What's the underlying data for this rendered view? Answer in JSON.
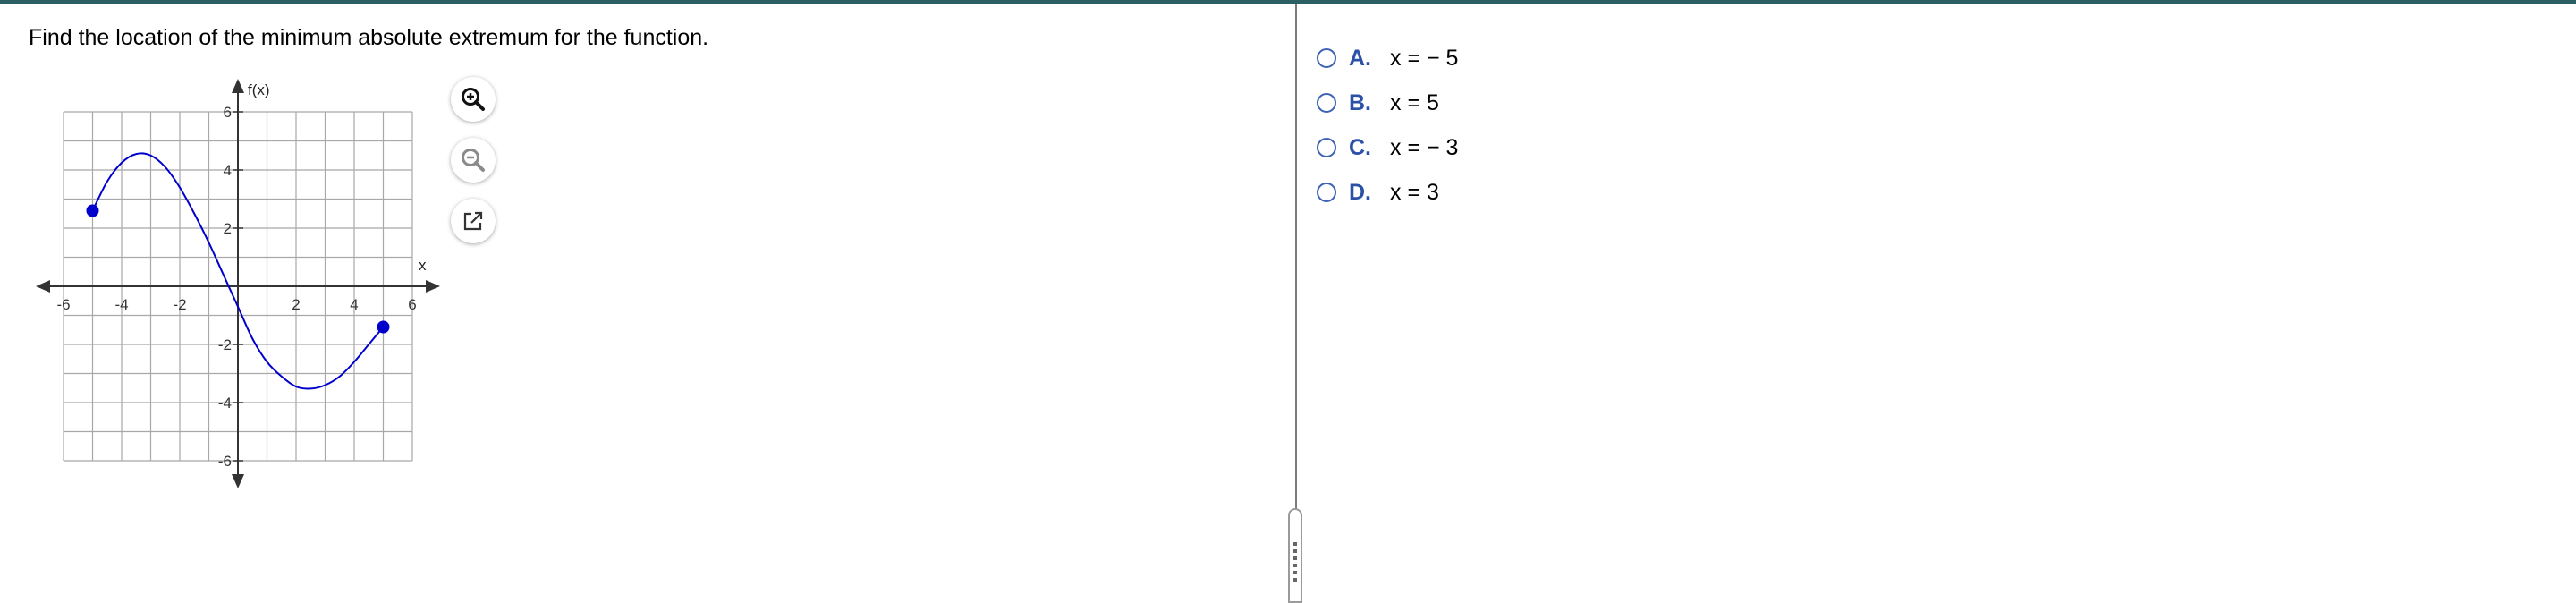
{
  "question": {
    "text": "Find the location of the minimum absolute extremum for the function."
  },
  "graph": {
    "y_axis_label": "f(x)",
    "x_axis_label": "x",
    "x_ticks": [
      "-6",
      "-4",
      "-2",
      "2",
      "4",
      "6"
    ],
    "y_ticks": [
      "6",
      "4",
      "2",
      "-2",
      "-4",
      "-6"
    ],
    "x_range": [
      -6,
      6
    ],
    "y_range": [
      -6,
      6
    ],
    "grid_step": 1,
    "curve_points": [
      [
        -5,
        2.6
      ],
      [
        -4.5,
        3.6
      ],
      [
        -4,
        4.25
      ],
      [
        -3.5,
        4.55
      ],
      [
        -3,
        4.5
      ],
      [
        -2.5,
        4.1
      ],
      [
        -2,
        3.4
      ],
      [
        -1.5,
        2.5
      ],
      [
        -1,
        1.5
      ],
      [
        -0.5,
        0.4
      ],
      [
        0,
        -0.7
      ],
      [
        0.5,
        -1.8
      ],
      [
        1,
        -2.6
      ],
      [
        1.5,
        -3.1
      ],
      [
        2,
        -3.45
      ],
      [
        2.5,
        -3.52
      ],
      [
        3,
        -3.4
      ],
      [
        3.5,
        -3.1
      ],
      [
        4,
        -2.6
      ],
      [
        4.5,
        -2.0
      ],
      [
        5,
        -1.4
      ]
    ],
    "endpoints": [
      [
        -5,
        2.6
      ],
      [
        5,
        -1.4
      ]
    ],
    "curve_color": "#0000cc",
    "grid_color": "#a8a8a8"
  },
  "tools": {
    "zoom_in": "zoom-in-icon",
    "zoom_out": "zoom-out-icon",
    "popout": "popout-icon"
  },
  "choices": [
    {
      "letter": "A.",
      "text": "x = − 5"
    },
    {
      "letter": "B.",
      "text": "x = 5"
    },
    {
      "letter": "C.",
      "text": "x = − 3"
    },
    {
      "letter": "D.",
      "text": "x = 3"
    }
  ],
  "colors": {
    "accent": "#2b50a8",
    "header": "#2c5f63"
  }
}
